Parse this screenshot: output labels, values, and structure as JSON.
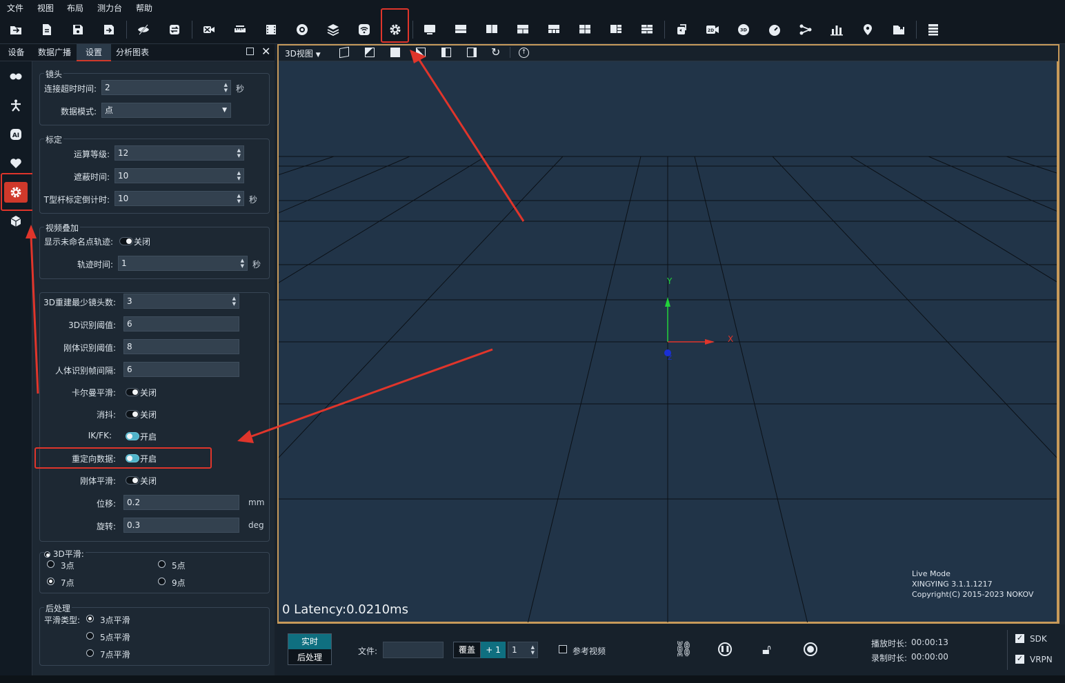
{
  "menu": [
    "文件",
    "视图",
    "布局",
    "测力台",
    "帮助"
  ],
  "toolbar_icons": [
    "open-folder-icon",
    "new-file-icon",
    "save-icon",
    "save-as-icon",
    "hide-icon",
    "sync-icon",
    "camera-off-icon",
    "ruler-icon",
    "film-icon",
    "target-icon",
    "layers-icon",
    "wifi-box-icon",
    "settings-icon",
    "monitor-icon",
    "layout-1-icon",
    "layout-2-icon",
    "layout-3-icon",
    "layout-4-icon",
    "layout-5-icon",
    "layout-6-icon",
    "layout-7-icon",
    "rotate-box-icon",
    "2d-view-icon",
    "3d-view-icon",
    "gauge-icon",
    "network-icon",
    "bar-chart-icon",
    "location-icon",
    "folder-icon",
    "list-icon"
  ],
  "tabs": [
    "设备",
    "数据广播",
    "设置",
    "分析图表"
  ],
  "active_tab": "设置",
  "side_icons": [
    "markers-icon",
    "skeleton-icon",
    "ai-icon",
    "heart-icon",
    "settings-icon",
    "cube-icon"
  ],
  "lens": {
    "title": "镜头",
    "timeout_label": "连接超时时间:",
    "timeout_value": "2",
    "timeout_unit": "秒",
    "mode_label": "数据模式:",
    "mode_value": "点"
  },
  "calib": {
    "title": "标定",
    "level_label": "运算等级:",
    "level_value": "12",
    "occlude_label": "遮蔽时间:",
    "occlude_value": "10",
    "tbar_label": "T型杆标定倒计时:",
    "tbar_value": "10",
    "tbar_unit": "秒"
  },
  "overlay": {
    "title": "视频叠加",
    "unnamed_label": "显示未命名点轨迹:",
    "unnamed_state": "关闭",
    "trail_label": "轨迹时间:",
    "trail_value": "1",
    "trail_unit": "秒"
  },
  "recon": {
    "min_cam_label": "3D重建最少镜头数:",
    "min_cam_value": "3",
    "thresh3d_label": "3D识别阈值:",
    "thresh3d_value": "6",
    "rigid_label": "刚体识别阈值:",
    "rigid_value": "8",
    "human_label": "人体识别帧间隔:",
    "human_value": "6",
    "kalman_label": "卡尔曼平滑:",
    "kalman_state": "关闭",
    "debounce_label": "消抖:",
    "debounce_state": "关闭",
    "ikfk_label": "IK/FK:",
    "ikfk_state": "开启",
    "retarget_label": "重定向数据:",
    "retarget_state": "开启",
    "rigid_smooth_label": "刚体平滑:",
    "rigid_smooth_state": "关闭",
    "disp_label": "位移:",
    "disp_value": "0.2",
    "disp_unit": "mm",
    "rot_label": "旋转:",
    "rot_value": "0.3",
    "rot_unit": "deg"
  },
  "smooth3d": {
    "title": "3D平滑:",
    "options": [
      "3点",
      "5点",
      "7点",
      "9点"
    ],
    "selected": "7点"
  },
  "post": {
    "title": "后处理",
    "type_label": "平滑类型:",
    "options": [
      "3点平滑",
      "5点平滑",
      "7点平滑"
    ],
    "selected": "3点平滑"
  },
  "view": {
    "mode_label": "3D视图",
    "latency": "0 Latency:0.0210ms",
    "axis_y": "Y",
    "axis_x": "X",
    "axis_z": "Z",
    "info_mode": "Live Mode",
    "info_version": "XINGYING 3.1.1.1217",
    "info_copyright": "Copyright(C) 2015-2023 NOKOV"
  },
  "bottom": {
    "realtime": "实时",
    "postproc": "后处理",
    "file_label": "文件:",
    "file_value": "",
    "overwrite": "覆盖",
    "plus_one": "+ 1",
    "count_value": "1",
    "ref_video": "参考视频",
    "play_label": "播放时长:",
    "play_value": "00:00:13",
    "rec_label": "录制时长:",
    "rec_value": "00:00:00",
    "sdk": "SDK",
    "vrpn": "VRPN"
  },
  "colors": {
    "highlight": "#e0352b",
    "accent": "#4fb3c9",
    "view_border": "#c79a5a",
    "axis_x": "#e0352b",
    "axis_y": "#22d33a",
    "axis_z": "#1a2fd6"
  }
}
